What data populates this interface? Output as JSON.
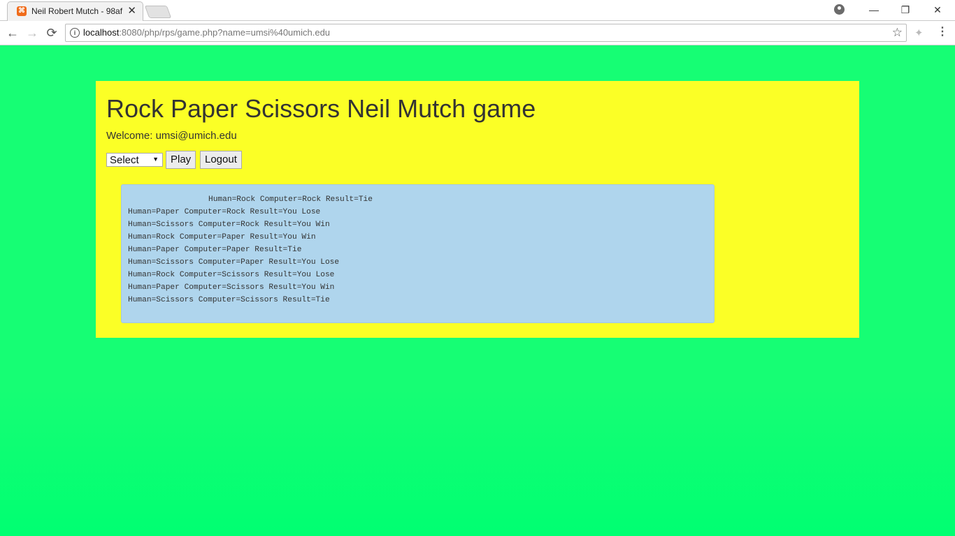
{
  "browser": {
    "tab_title": "Neil Robert Mutch - 98af",
    "tab_close": "✕",
    "favicon_glyph": "⌘",
    "url_host": "localhost",
    "url_rest": ":8080/php/rps/game.php?name=umsi%40umich.edu",
    "info_glyph": "i",
    "star_glyph": "☆",
    "back_glyph": "←",
    "forward_glyph": "→",
    "reload_glyph": "⟳",
    "minimize_glyph": "—",
    "restore_glyph": "❐",
    "close_glyph": "✕",
    "menu_glyph": "⋮",
    "ext_glyph": "✦"
  },
  "colors": {
    "page_bg": "#16fe74",
    "container_bg": "#fbff26",
    "results_bg": "#afd5ed"
  },
  "page": {
    "title": "Rock Paper Scissors Neil Mutch game",
    "welcome": "Welcome: umsi@umich.edu",
    "select_value": "Select",
    "play_label": "Play",
    "logout_label": "Logout",
    "results": [
      "Human=Rock Computer=Rock Result=Tie",
      "Human=Paper Computer=Rock Result=You Lose",
      "Human=Scissors Computer=Rock Result=You Win",
      "Human=Rock Computer=Paper Result=You Win",
      "Human=Paper Computer=Paper Result=Tie",
      "Human=Scissors Computer=Paper Result=You Lose",
      "Human=Rock Computer=Scissors Result=You Lose",
      "Human=Paper Computer=Scissors Result=You Win",
      "Human=Scissors Computer=Scissors Result=Tie"
    ]
  }
}
